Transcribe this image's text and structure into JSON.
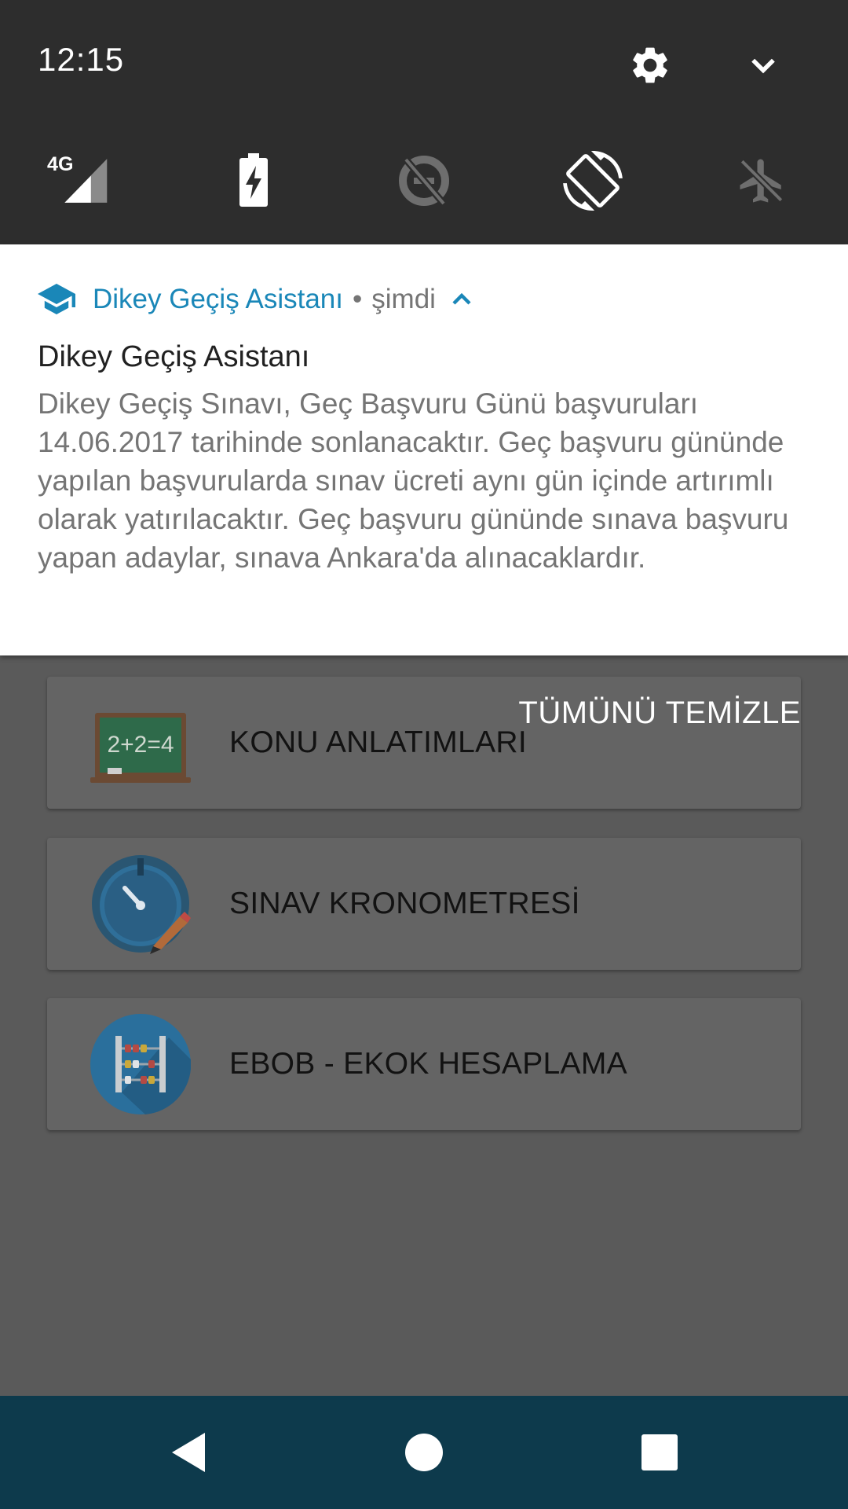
{
  "status": {
    "time": "12:15"
  },
  "quick_settings": {
    "tiles": [
      {
        "name": "mobile-data",
        "label": "4G",
        "icon": "signal-icon"
      },
      {
        "name": "battery-saver",
        "icon": "battery-charging-icon"
      },
      {
        "name": "data-saver",
        "icon": "data-saver-off-icon"
      },
      {
        "name": "auto-rotate",
        "icon": "screen-rotation-icon"
      },
      {
        "name": "airplane-mode",
        "icon": "airplane-icon"
      }
    ]
  },
  "notification": {
    "app_name": "Dikey Geçiş Asistanı",
    "separator": "•",
    "time": "şimdi",
    "title": "Dikey Geçiş Asistanı",
    "body": "Dikey Geçiş Sınavı, Geç Başvuru Günü başvuruları 14.06.2017 tarihinde sonlanacaktır. Geç başvuru gününde yapılan başvurularda sınav ücreti aynı gün içinde artırımlı olarak yatırılacaktır. Geç başvuru gününde sınava başvuru yapan adaylar, sınava Ankara'da alınacaklardır.",
    "accent": "#1a87b8"
  },
  "clear_all": "TÜMÜNÜ TEMİZLE",
  "board_text": "2+2=4",
  "menu": [
    {
      "label": "KONU ANLATIMLARI",
      "icon": "chalkboard-icon"
    },
    {
      "label": "SINAV KRONOMETRESİ",
      "icon": "stopwatch-icon"
    },
    {
      "label": "EBOB - EKOK HESAPLAMA",
      "icon": "abacus-icon"
    }
  ],
  "navbar": {
    "buttons": [
      "back",
      "home",
      "recents"
    ]
  }
}
